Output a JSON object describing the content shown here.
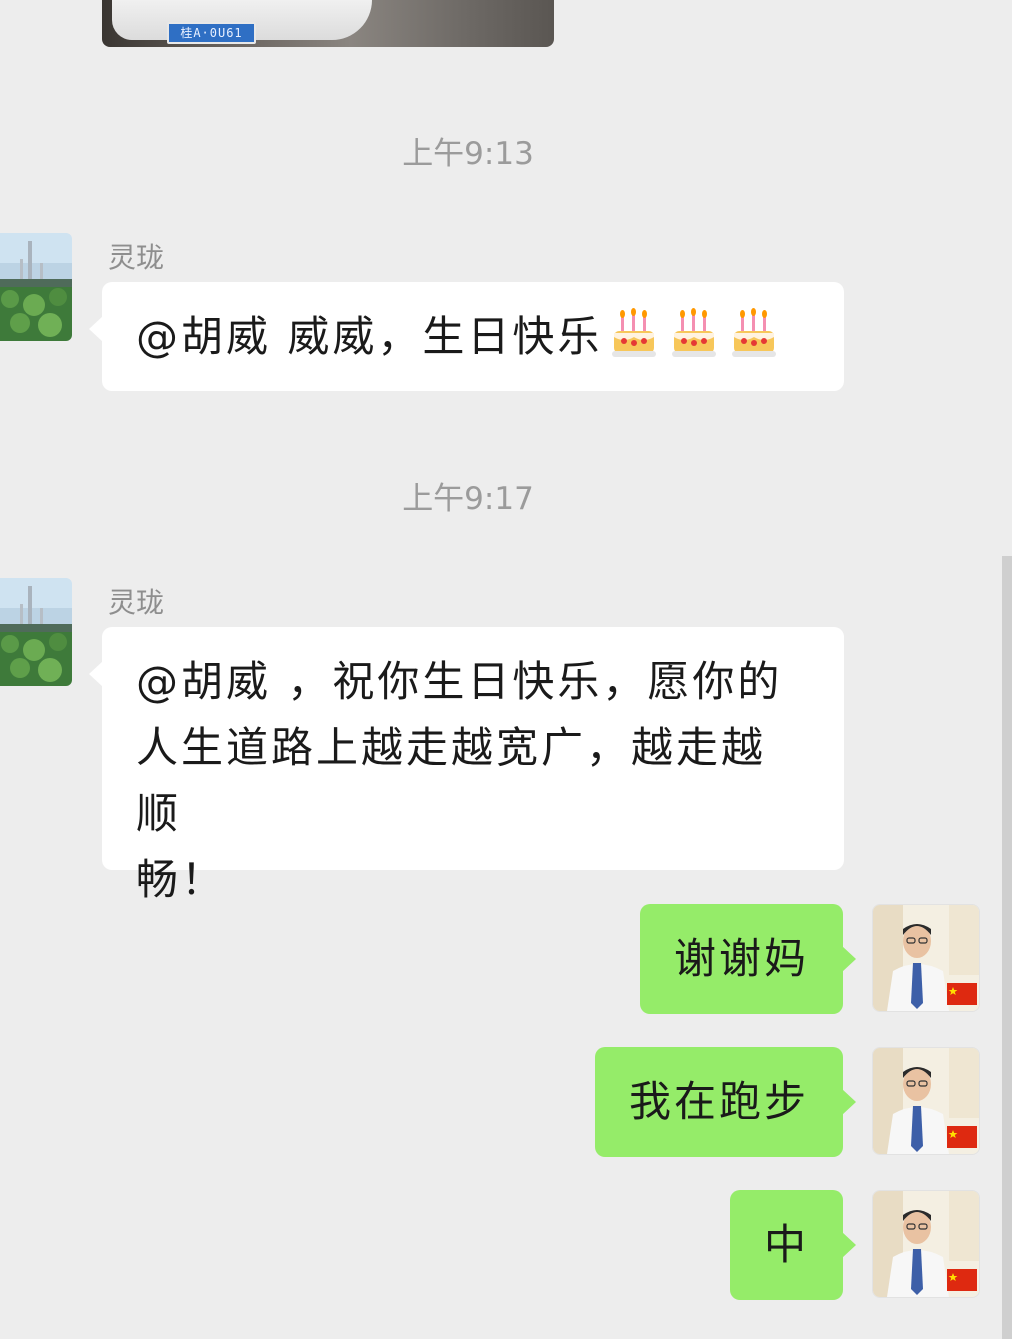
{
  "photo_message": {
    "plate_text": "桂A·0U61"
  },
  "timestamps": [
    "上午9:13",
    "上午9:17"
  ],
  "messages": [
    {
      "sender": "灵珑",
      "text": "@胡威  威威，生日快乐",
      "emoji": "birthday-cake"
    },
    {
      "sender": "灵珑",
      "lines": [
        "@胡威 ，祝你生日快乐，愿你的",
        "人生道路上越走越宽广，越走越顺",
        "畅！"
      ]
    }
  ],
  "my_messages": [
    "谢谢妈",
    "我在跑步",
    "中"
  ],
  "colors": {
    "background": "#ededed",
    "incoming_bubble": "#ffffff",
    "outgoing_bubble": "#95ec69",
    "timestamp": "#9b9b9b"
  }
}
